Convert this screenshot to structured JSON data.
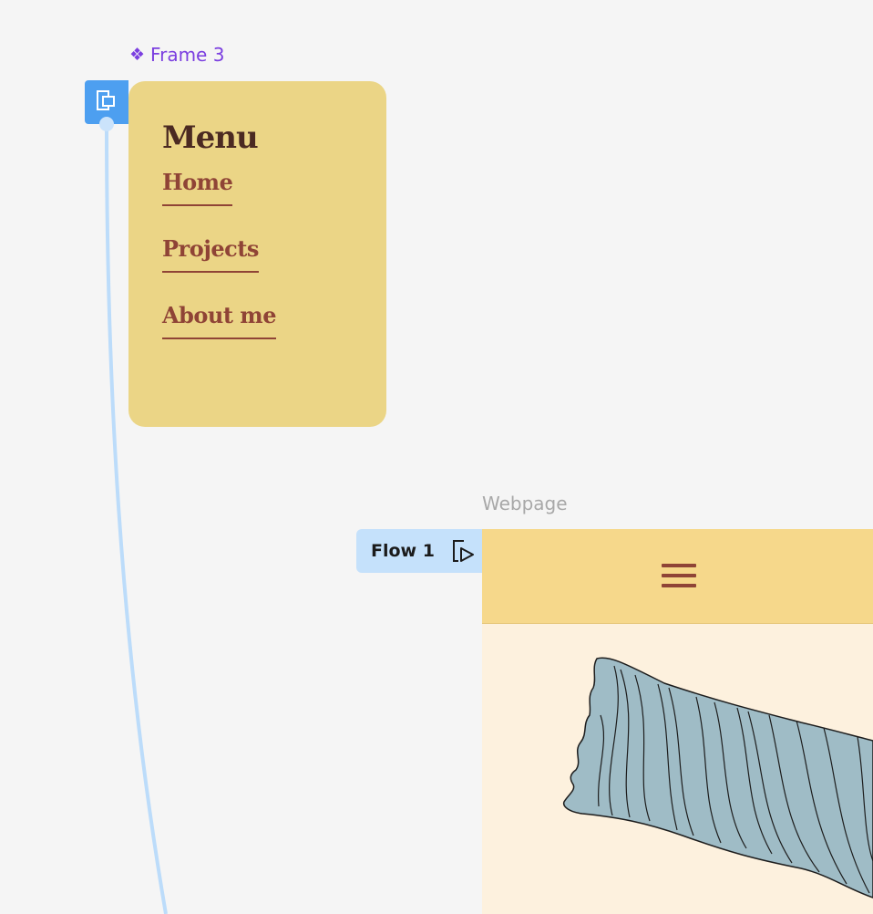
{
  "canvas": {
    "background": "#f5f5f5"
  },
  "frame3": {
    "label": "Frame 3",
    "label_icon": "component-icon",
    "label_color": "#7b3fe0"
  },
  "menu": {
    "title": "Menu",
    "items": [
      {
        "label": "Home"
      },
      {
        "label": "Projects"
      },
      {
        "label": "About me"
      }
    ],
    "background": "#ebd586",
    "title_color": "#4b2a22",
    "link_color": "#8f4436"
  },
  "webpage": {
    "label": "Webpage",
    "header_color": "#f6d88b",
    "body_color": "#fdf1de",
    "menu_icon": "hamburger-icon",
    "illustration": "wood-log-illustration",
    "illustration_color": "#9fbcc6"
  },
  "flow": {
    "label": "Flow 1",
    "icon": "play-frame-icon",
    "tab_color": "#c5e1fb"
  },
  "prototype": {
    "handle_icon": "prototype-start-icon",
    "handle_color": "#4d9ff0",
    "connector_color": "#bcdcfa"
  }
}
